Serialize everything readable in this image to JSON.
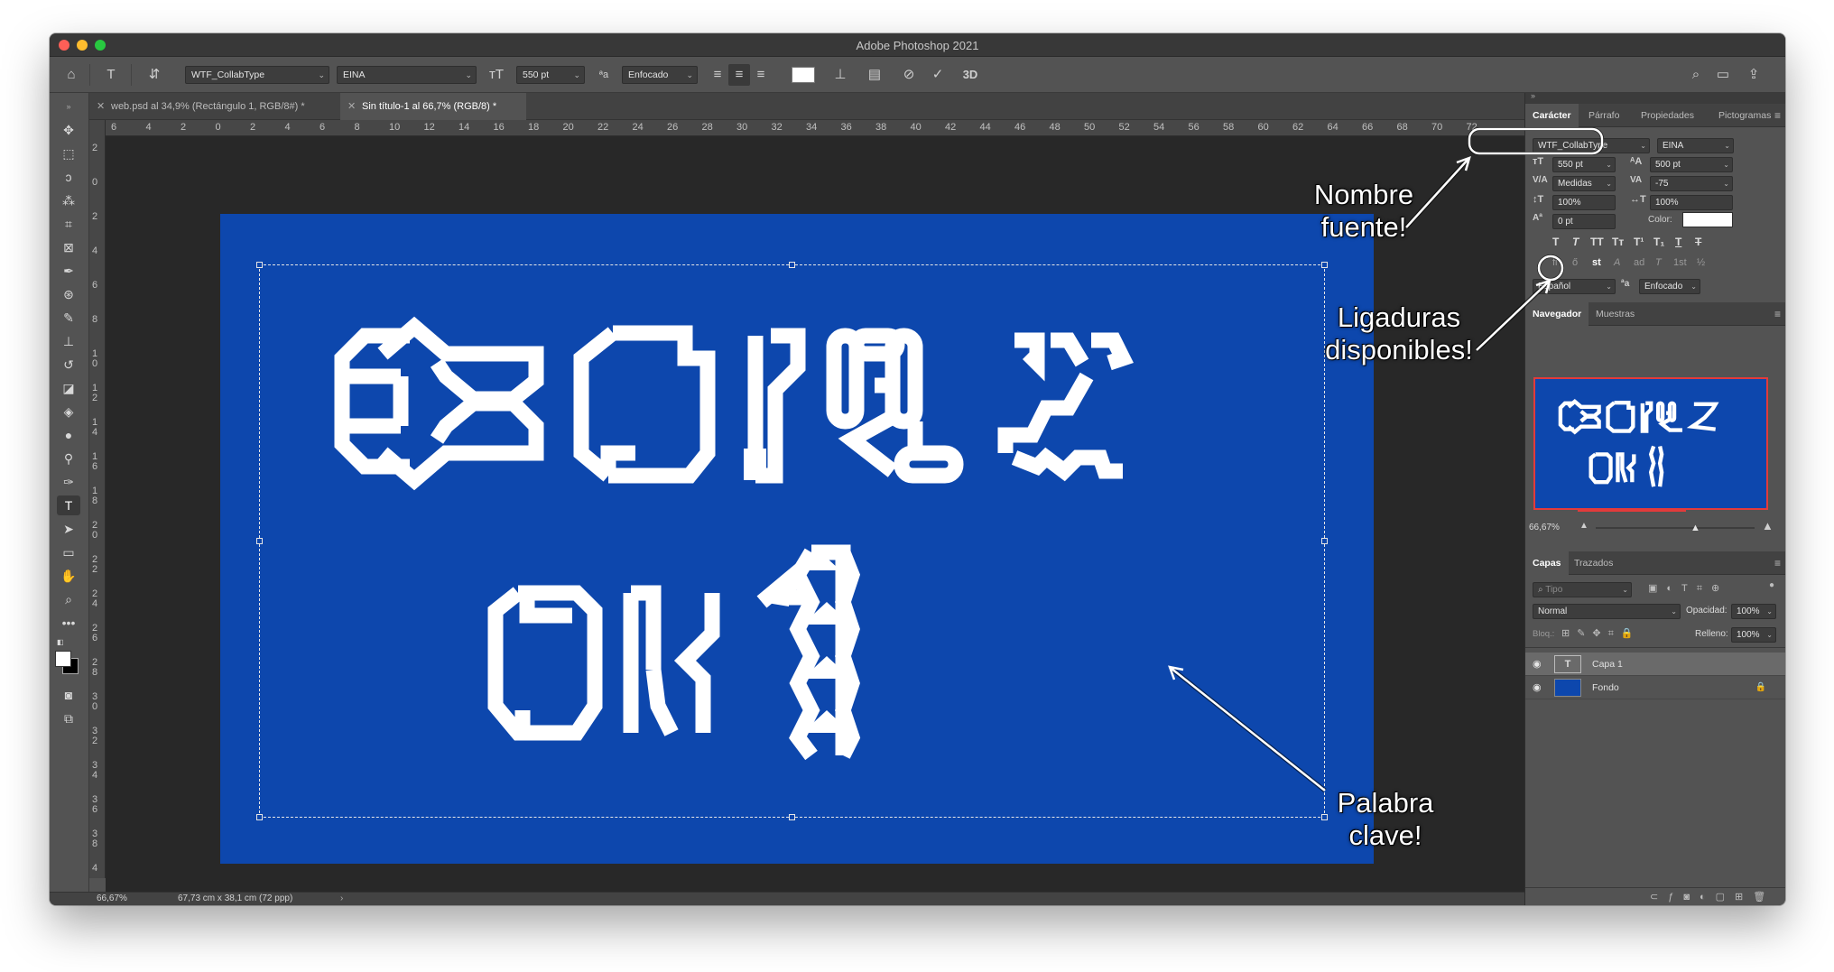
{
  "window": {
    "title": "Adobe Photoshop 2021"
  },
  "options_bar": {
    "font_family": "WTF_CollabType",
    "font_style": "EINA",
    "font_size": "550 pt",
    "antialias": "Enfocado",
    "icons": [
      "home-icon",
      "type-tool-icon",
      "text-orientation-icon",
      "font-size-icon",
      "antialias-icon",
      "align-left-icon",
      "align-center-icon",
      "align-right-icon",
      "color-swatch",
      "warp-text-icon",
      "toggle-panels-icon",
      "cancel-icon",
      "commit-icon",
      "3d-icon",
      "search-icon",
      "workspace-icon",
      "share-icon"
    ],
    "3d_label": "3D"
  },
  "tabs": [
    {
      "label": "web.psd al 34,9% (Rectángulo 1, RGB/8#) *",
      "active": false
    },
    {
      "label": "Sin título-1 al 66,7% (RGB/8) *",
      "active": true
    }
  ],
  "ruler_h": [
    "6",
    "4",
    "2",
    "0",
    "2",
    "4",
    "6",
    "8",
    "10",
    "12",
    "14",
    "16",
    "18",
    "20",
    "22",
    "24",
    "26",
    "28",
    "30",
    "32",
    "34",
    "36",
    "38",
    "40",
    "42",
    "44",
    "46",
    "48",
    "50",
    "52",
    "54",
    "56",
    "58",
    "60",
    "62",
    "64",
    "66",
    "68",
    "70",
    "72"
  ],
  "ruler_v": [
    "2",
    "0",
    "2",
    "4",
    "6",
    "8",
    "1 0",
    "1 2",
    "1 4",
    "1 6",
    "1 8",
    "2 0",
    "2 2",
    "2 4",
    "2 6",
    "2 8",
    "3 0",
    "3 2",
    "3 4",
    "3 6",
    "3 8",
    "4"
  ],
  "canvas": {
    "background": "#0d47ad",
    "glyph_color": "#ffffff"
  },
  "status": {
    "zoom": "66,67%",
    "doc_size": "67,73 cm x 38,1 cm (72 ppp)"
  },
  "character_panel": {
    "tabs": [
      "Carácter",
      "Párrafo",
      "Propiedades",
      "Pictogramas"
    ],
    "font_family": "WTF_CollabType",
    "font_style": "EINA",
    "size": "550 pt",
    "leading": "500 pt",
    "kerning": "Medidas",
    "tracking": "-75",
    "vertical_scale": "100%",
    "horizontal_scale": "100%",
    "baseline_shift": "0 pt",
    "color_label": "Color:",
    "language": "Español",
    "antialias": "Enfocado",
    "style_buttons": [
      "T",
      "T",
      "TT",
      "Tт",
      "T¹",
      "T₁",
      "T",
      "T"
    ],
    "opentype_buttons": [
      "fi",
      "ő",
      "st",
      "A",
      "ad",
      "T",
      "1st",
      "½"
    ]
  },
  "navigator_panel": {
    "tabs": [
      "Navegador",
      "Muestras"
    ],
    "zoom": "66,67%"
  },
  "layers_panel": {
    "tabs": [
      "Capas",
      "Trazados"
    ],
    "filter_placeholder": "Tipo",
    "blend_mode": "Normal",
    "opacity_label": "Opacidad:",
    "opacity": "100%",
    "lock_label": "Bloq.:",
    "fill_label": "Relleno:",
    "fill": "100%",
    "layers": [
      {
        "name": "Capa 1",
        "type": "text",
        "selected": true
      },
      {
        "name": "Fondo",
        "type": "fill",
        "locked": true
      }
    ]
  },
  "annotations": {
    "font_name": "Nombre\nfuente!",
    "ligatures": "Ligaduras\ndisponibles!",
    "keyword": "Palabra\nclave!"
  }
}
